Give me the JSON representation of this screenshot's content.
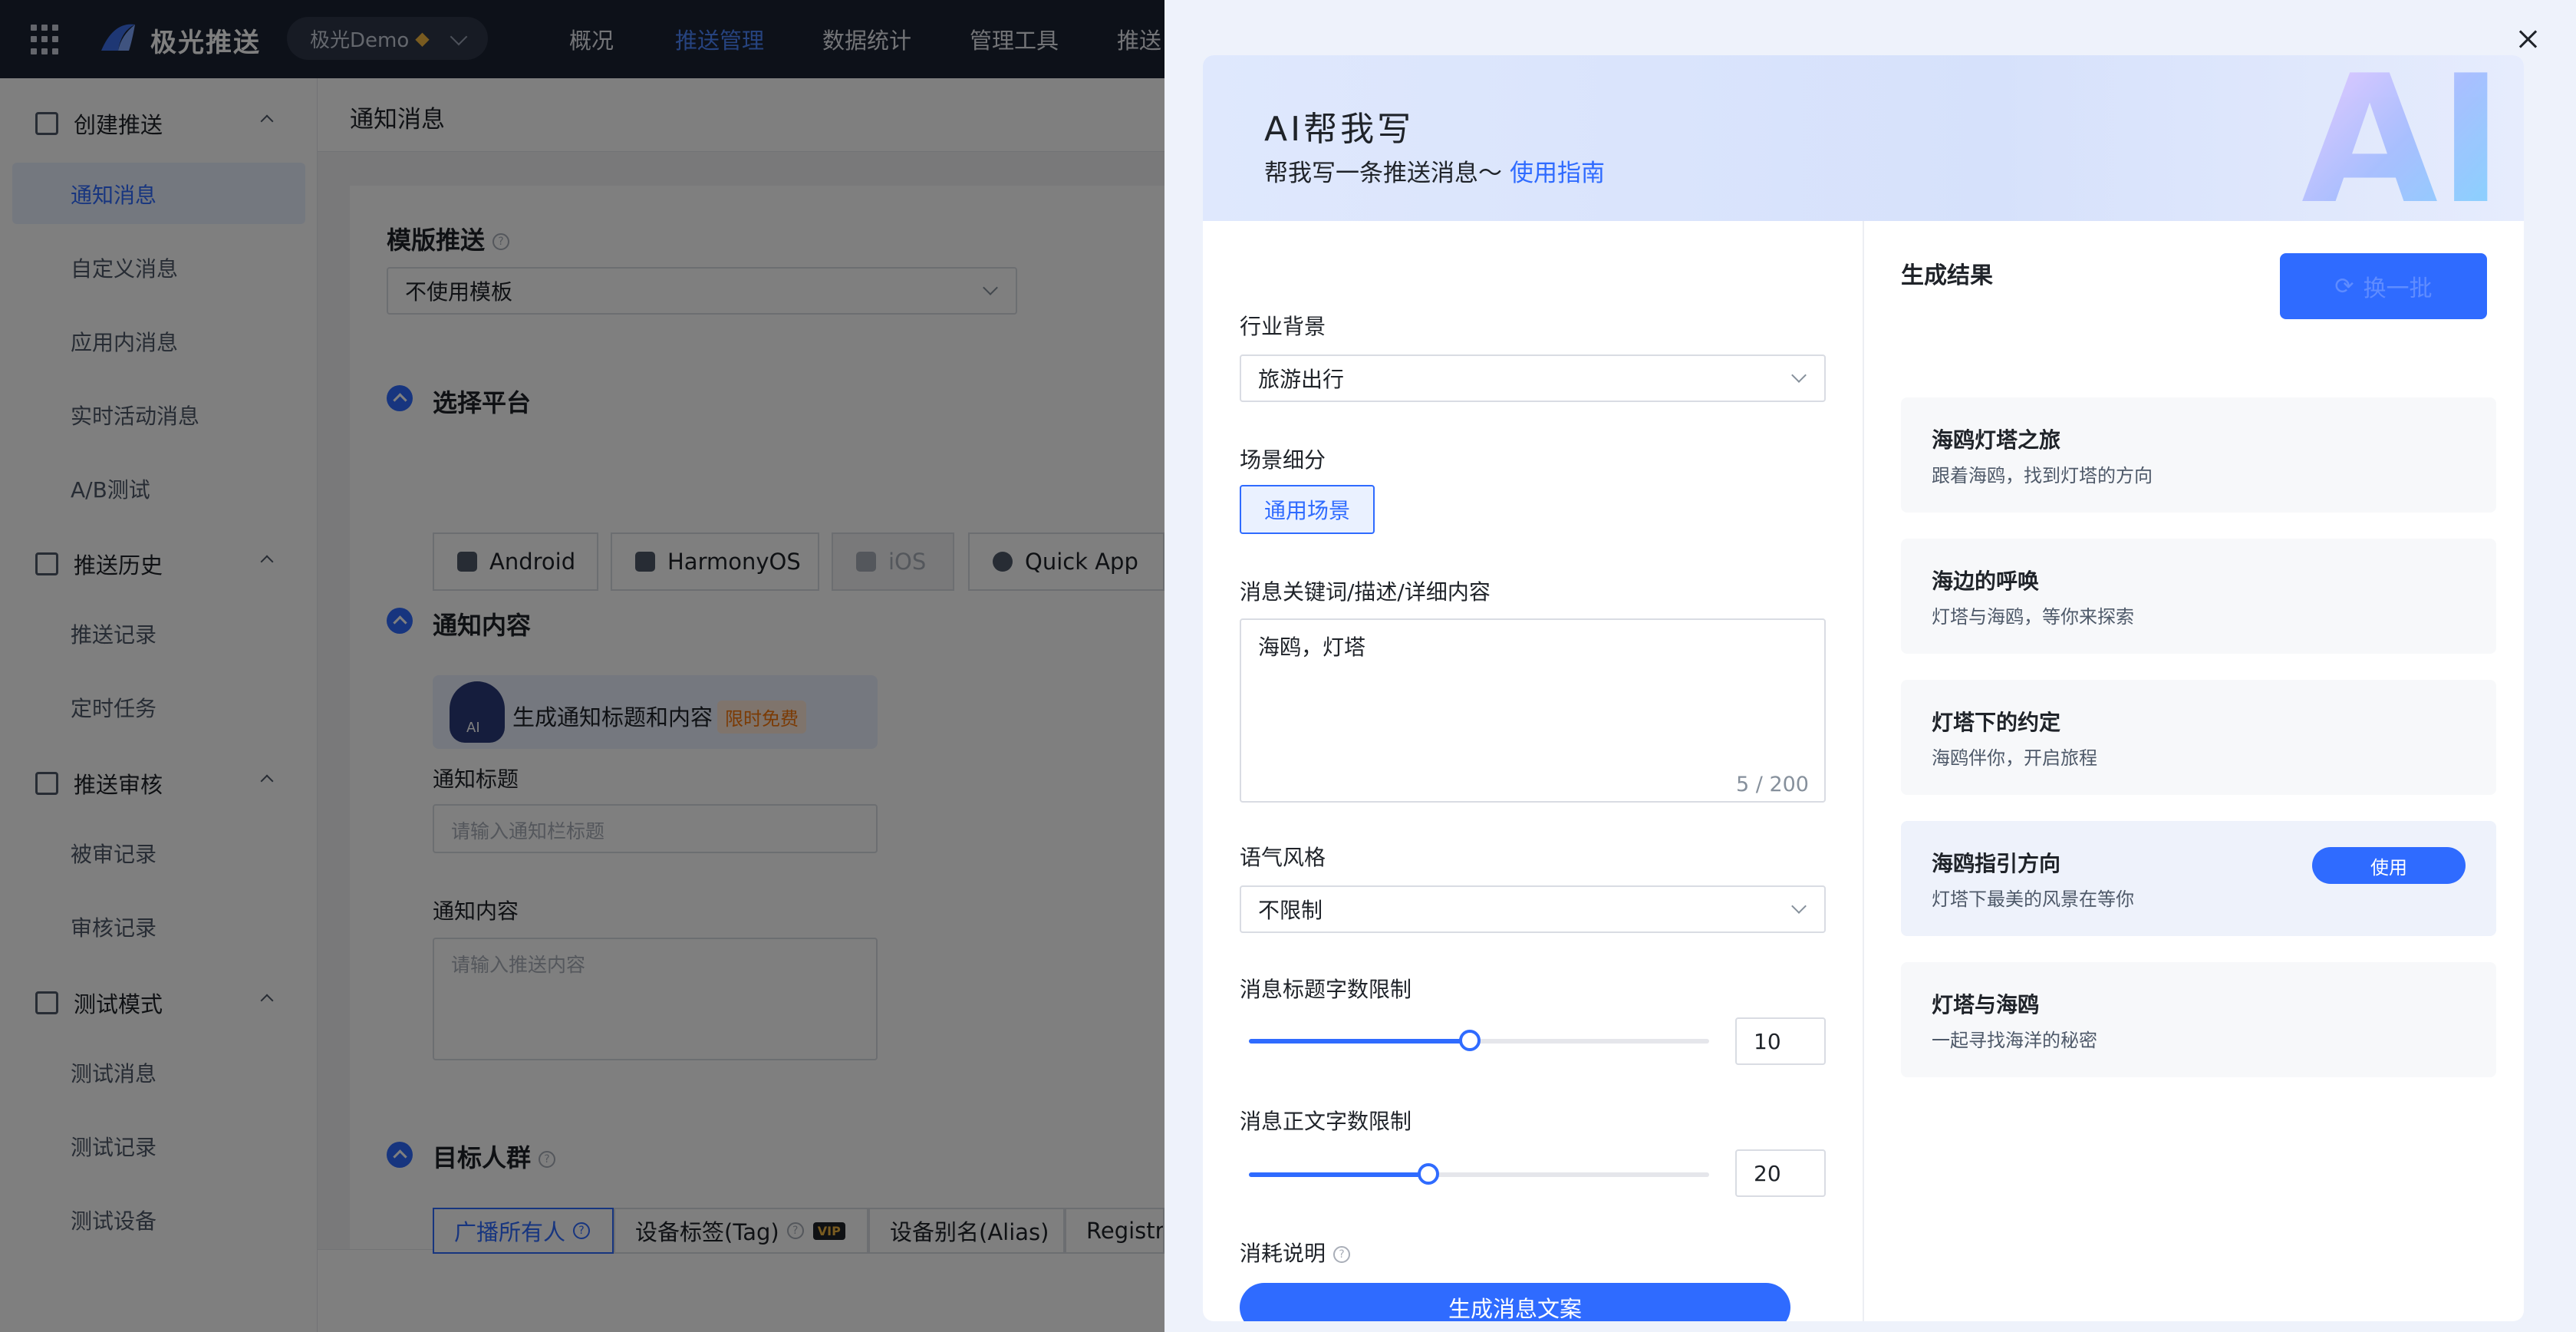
{
  "topbar": {
    "brand": "极光推送",
    "app_name": "极光Demo",
    "nav": [
      "概况",
      "推送管理",
      "数据统计",
      "管理工具",
      "推送"
    ]
  },
  "sidebar": {
    "groups": [
      {
        "label": "创建推送",
        "items": [
          "通知消息",
          "自定义消息",
          "应用内消息",
          "实时活动消息",
          "A/B测试"
        ]
      },
      {
        "label": "推送历史",
        "items": [
          "推送记录",
          "定时任务"
        ]
      },
      {
        "label": "推送审核",
        "items": [
          "被审记录",
          "审核记录"
        ]
      },
      {
        "label": "测试模式",
        "items": [
          "测试消息",
          "测试记录",
          "测试设备"
        ]
      }
    ]
  },
  "main": {
    "page_title": "通知消息",
    "template_label": "模版推送",
    "template_value": "不使用模板",
    "platform_label": "选择平台",
    "platforms": [
      "Android",
      "HarmonyOS",
      "iOS",
      "Quick App"
    ],
    "content_label": "通知内容",
    "ai_strip_text": "生成通知标题和内容",
    "ai_strip_tag": "限时免费",
    "title_label": "通知标题",
    "title_placeholder": "请输入通知栏标题",
    "body_label": "通知内容",
    "body_placeholder": "请输入推送内容",
    "audience_label": "目标人群",
    "audience_tabs": [
      "广播所有人",
      "设备标签(Tag)",
      "设备别名(Alias)",
      "Registra"
    ],
    "vip": "VIP"
  },
  "drawer": {
    "title": "AI帮我写",
    "subtitle": "帮我写一条推送消息～",
    "guide_link": "使用指南",
    "art_text": "AI",
    "industry_label": "行业背景",
    "industry_value": "旅游出行",
    "scene_label": "场景细分",
    "scene_value": "通用场景",
    "keywords_label": "消息关键词/描述/详细内容",
    "keywords_value": "海鸥，灯塔",
    "keywords_counter": "5 / 200",
    "tone_label": "语气风格",
    "tone_value": "不限制",
    "title_limit_label": "消息标题字数限制",
    "title_limit_value": "10",
    "title_limit_fraction": 0.48,
    "body_limit_label": "消息正文字数限制",
    "body_limit_value": "20",
    "body_limit_fraction": 0.39,
    "cost_label": "消耗说明",
    "generate_label": "生成消息文案",
    "results_title": "生成结果",
    "refresh_label": "换一批",
    "use_label": "使用",
    "results": [
      {
        "title": "海鸥灯塔之旅",
        "body": "跟着海鸥，找到灯塔的方向"
      },
      {
        "title": "海边的呼唤",
        "body": "灯塔与海鸥，等你来探索"
      },
      {
        "title": "灯塔下的约定",
        "body": "海鸥伴你，开启旅程"
      },
      {
        "title": "海鸥指引方向",
        "body": "灯塔下最美的风景在等你"
      },
      {
        "title": "灯塔与海鸥",
        "body": "一起寻找海洋的秘密"
      }
    ]
  },
  "colors": {
    "primary": "#2f6bff",
    "topbar_bg": "#1b2233",
    "overlay": "rgba(0,0,0,0.5)"
  }
}
